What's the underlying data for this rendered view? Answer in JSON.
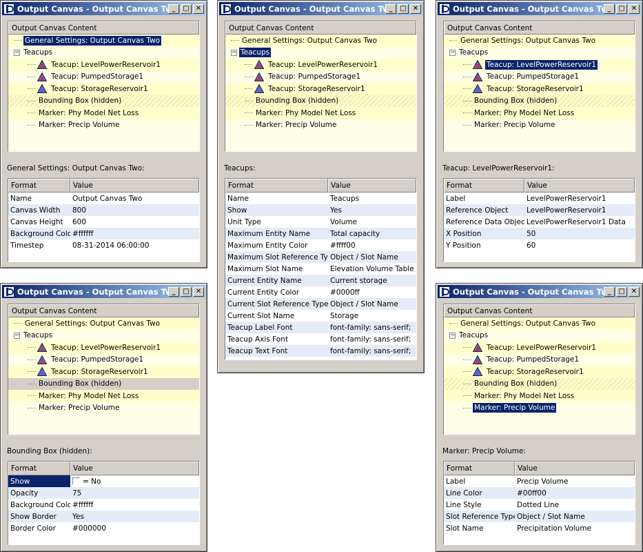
{
  "windows": [
    {
      "title": "Output Canvas - Output Canvas Two",
      "tree_header": "Output Canvas Content",
      "tree": [
        {
          "label": "General Settings: Output Canvas Two",
          "level": 0,
          "type": "leaf",
          "style": "odd",
          "selected": true
        },
        {
          "label": "Teacups",
          "level": 0,
          "type": "group",
          "style": "even",
          "selected": false
        },
        {
          "label": "Teacup: LevelPowerReservoir1",
          "level": 1,
          "type": "teacup",
          "icon": "mixed",
          "style": "odd",
          "selected": false
        },
        {
          "label": "Teacup: PumpedStorage1",
          "level": 1,
          "type": "teacup",
          "icon": "mixed",
          "style": "even",
          "selected": false
        },
        {
          "label": "Teacup: StorageReservoir1",
          "level": 1,
          "type": "teacup",
          "icon": "blue",
          "style": "odd",
          "selected": false
        },
        {
          "label": "Bounding Box (hidden)",
          "level": 1,
          "type": "leaf",
          "style": "hatch",
          "selected": false
        },
        {
          "label": "Marker: Phy Model Net Loss",
          "level": 1,
          "type": "leaf",
          "style": "odd",
          "selected": false
        },
        {
          "label": "Marker: Precip Volume",
          "level": 1,
          "type": "leaf",
          "style": "even",
          "selected": false
        }
      ],
      "section_label": "General Settings: Output Canvas Two:",
      "grid_headers": [
        "Format",
        "Value"
      ],
      "grid_rows": [
        [
          "Name",
          "Output Canvas Two"
        ],
        [
          "Canvas Width",
          "800"
        ],
        [
          "Canvas Height",
          "600"
        ],
        [
          "Background Color",
          "#ffffff"
        ],
        [
          "Timestep",
          "08-31-2014 06:00:00"
        ]
      ]
    },
    {
      "title": "Output Canvas - Output Canvas Two",
      "tree_header": "Output Canvas Content",
      "tree": [
        {
          "label": "General Settings: Output Canvas Two",
          "level": 0,
          "type": "leaf",
          "style": "odd",
          "selected": false
        },
        {
          "label": "Teacups",
          "level": 0,
          "type": "group",
          "style": "even",
          "selected": true
        },
        {
          "label": "Teacup: LevelPowerReservoir1",
          "level": 1,
          "type": "teacup",
          "icon": "mixed",
          "style": "odd",
          "selected": false
        },
        {
          "label": "Teacup: PumpedStorage1",
          "level": 1,
          "type": "teacup",
          "icon": "mixed",
          "style": "even",
          "selected": false
        },
        {
          "label": "Teacup: StorageReservoir1",
          "level": 1,
          "type": "teacup",
          "icon": "blue",
          "style": "odd",
          "selected": false
        },
        {
          "label": "Bounding Box (hidden)",
          "level": 1,
          "type": "leaf",
          "style": "hatch",
          "selected": false
        },
        {
          "label": "Marker: Phy Model Net Loss",
          "level": 1,
          "type": "leaf",
          "style": "odd",
          "selected": false
        },
        {
          "label": "Marker: Precip Volume",
          "level": 1,
          "type": "leaf",
          "style": "even",
          "selected": false
        }
      ],
      "section_label": "Teacups:",
      "grid_headers": [
        "Format",
        "Value"
      ],
      "grid_rows": [
        [
          "Name",
          "Teacups"
        ],
        [
          "Show",
          "Yes"
        ],
        [
          "Unit Type",
          "Volume"
        ],
        [
          "Maximum Entity Name",
          "Total capacity"
        ],
        [
          "Maximum Entity Color",
          "#ffff00"
        ],
        [
          "Maximum Slot Reference Type",
          "Object / Slot Name"
        ],
        [
          "Maximum Slot Name",
          "Elevation Volume Table"
        ],
        [
          "Current Entity Name",
          "Current storage"
        ],
        [
          "Current Entity Color",
          "#0000ff"
        ],
        [
          "Current Slot Reference Type",
          "Object / Slot Name"
        ],
        [
          "Current Slot Name",
          "Storage"
        ],
        [
          "Teacup Label Font",
          "font-family: sans-serif;"
        ],
        [
          "Teacup Axis Font",
          "font-family: sans-serif;"
        ],
        [
          "Teacup Text Font",
          "font-family: sans-serif;"
        ]
      ]
    },
    {
      "title": "Output Canvas - Output Canvas Two",
      "tree_header": "Output Canvas Content",
      "tree": [
        {
          "label": "General Settings: Output Canvas Two",
          "level": 0,
          "type": "leaf",
          "style": "odd",
          "selected": false
        },
        {
          "label": "Teacups",
          "level": 0,
          "type": "group",
          "style": "even",
          "selected": false
        },
        {
          "label": "Teacup: LevelPowerReservoir1",
          "level": 1,
          "type": "teacup",
          "icon": "mixed",
          "style": "odd",
          "selected": true
        },
        {
          "label": "Teacup: PumpedStorage1",
          "level": 1,
          "type": "teacup",
          "icon": "mixed",
          "style": "even",
          "selected": false
        },
        {
          "label": "Teacup: StorageReservoir1",
          "level": 1,
          "type": "teacup",
          "icon": "blue",
          "style": "odd",
          "selected": false
        },
        {
          "label": "Bounding Box (hidden)",
          "level": 1,
          "type": "leaf",
          "style": "hatch",
          "selected": false
        },
        {
          "label": "Marker: Phy Model Net Loss",
          "level": 1,
          "type": "leaf",
          "style": "odd",
          "selected": false
        },
        {
          "label": "Marker: Precip Volume",
          "level": 1,
          "type": "leaf",
          "style": "even",
          "selected": false
        }
      ],
      "section_label": "Teacup: LevelPowerReservoir1:",
      "grid_headers": [
        "Format",
        "Value"
      ],
      "grid_rows": [
        [
          "Label",
          "LevelPowerReservoir1"
        ],
        [
          "Reference Object",
          "LevelPowerReservoir1"
        ],
        [
          "Reference Data Object",
          "LevelPowerReservoir1 Data"
        ],
        [
          "X Position",
          "50"
        ],
        [
          "Y Position",
          "60"
        ]
      ]
    },
    {
      "title": "Output Canvas - Output Canvas Two",
      "tree_header": "Output Canvas Content",
      "tree": [
        {
          "label": "General Settings: Output Canvas Two",
          "level": 0,
          "type": "leaf",
          "style": "odd",
          "selected": false
        },
        {
          "label": "Teacups",
          "level": 0,
          "type": "group",
          "style": "even",
          "selected": false
        },
        {
          "label": "Teacup: LevelPowerReservoir1",
          "level": 1,
          "type": "teacup",
          "icon": "mixed",
          "style": "odd",
          "selected": false
        },
        {
          "label": "Teacup: PumpedStorage1",
          "level": 1,
          "type": "teacup",
          "icon": "mixed",
          "style": "even",
          "selected": false
        },
        {
          "label": "Teacup: StorageReservoir1",
          "level": 1,
          "type": "teacup",
          "icon": "blue",
          "style": "odd",
          "selected": false
        },
        {
          "label": "Bounding Box (hidden)",
          "level": 1,
          "type": "leaf",
          "style": "grey",
          "selected": false
        },
        {
          "label": "Marker: Phy Model Net Loss",
          "level": 1,
          "type": "leaf",
          "style": "odd",
          "selected": false
        },
        {
          "label": "Marker: Precip Volume",
          "level": 1,
          "type": "leaf",
          "style": "even",
          "selected": false
        }
      ],
      "section_label": "Bounding Box (hidden):",
      "grid_headers": [
        "Format",
        "Value"
      ],
      "grid_rows": [
        [
          "Show",
          "= No"
        ],
        [
          "Opacity",
          "75"
        ],
        [
          "Background Color",
          "#ffffff"
        ],
        [
          "Show Border",
          "Yes"
        ],
        [
          "Border Color",
          "#000000"
        ]
      ]
    },
    {
      "title": "Output Canvas - Output Canvas Two",
      "tree_header": "Output Canvas Content",
      "tree": [
        {
          "label": "General Settings: Output Canvas Two",
          "level": 0,
          "type": "leaf",
          "style": "odd",
          "selected": false
        },
        {
          "label": "Teacups",
          "level": 0,
          "type": "group",
          "style": "even",
          "selected": false
        },
        {
          "label": "Teacup: LevelPowerReservoir1",
          "level": 1,
          "type": "teacup",
          "icon": "mixed",
          "style": "odd",
          "selected": false
        },
        {
          "label": "Teacup: PumpedStorage1",
          "level": 1,
          "type": "teacup",
          "icon": "mixed",
          "style": "even",
          "selected": false
        },
        {
          "label": "Teacup: StorageReservoir1",
          "level": 1,
          "type": "teacup",
          "icon": "blue",
          "style": "odd",
          "selected": false
        },
        {
          "label": "Bounding Box (hidden)",
          "level": 1,
          "type": "leaf",
          "style": "hatch",
          "selected": false
        },
        {
          "label": "Marker: Phy Model Net Loss",
          "level": 1,
          "type": "leaf",
          "style": "odd",
          "selected": false
        },
        {
          "label": "Marker: Precip Volume",
          "level": 1,
          "type": "leaf",
          "style": "even",
          "selected": true
        }
      ],
      "section_label": "Marker: Precip Volume:",
      "grid_headers": [
        "Format",
        "Value"
      ],
      "grid_rows": [
        [
          "Label",
          "Precip Volume"
        ],
        [
          "Line Color",
          "#00ff00"
        ],
        [
          "Line Style",
          "Dotted Line"
        ],
        [
          "Slot Reference Type",
          "Object / Slot Name"
        ],
        [
          "Slot Name",
          "Precipitation Volume"
        ]
      ]
    }
  ],
  "titlebar_buttons": [
    "_",
    "□",
    "✕"
  ],
  "colors": {
    "title_start": "#0a246a",
    "title_end": "#a6caf0",
    "selection": "#0a246a",
    "tree_row_a": "#ffffcc",
    "tree_row_b": "#ffffe8",
    "grid_row_b": "#e4ecf8",
    "icon_red": "#cc3333",
    "icon_blue": "#5566dd"
  }
}
